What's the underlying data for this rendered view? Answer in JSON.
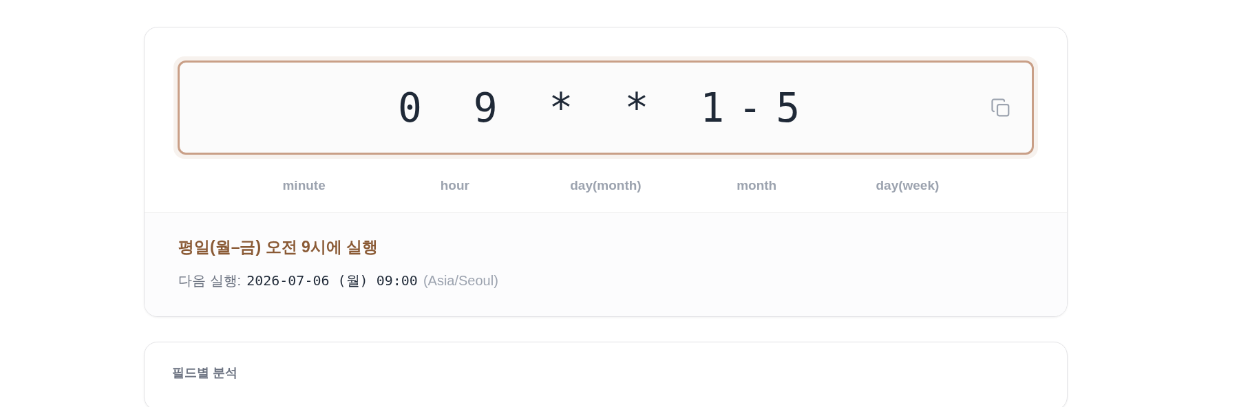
{
  "expression": {
    "value": "0 9 * * 1-5"
  },
  "fields": [
    "minute",
    "hour",
    "day(month)",
    "month",
    "day(week)"
  ],
  "summary": {
    "description": "평일(월–금) 오전 9시에 실행",
    "next_label": "다음 실행:",
    "next_value": "2026-07-06 (월) 09:00",
    "timezone": "(Asia/Seoul)"
  },
  "breakdown": {
    "title": "필드별 분석"
  }
}
